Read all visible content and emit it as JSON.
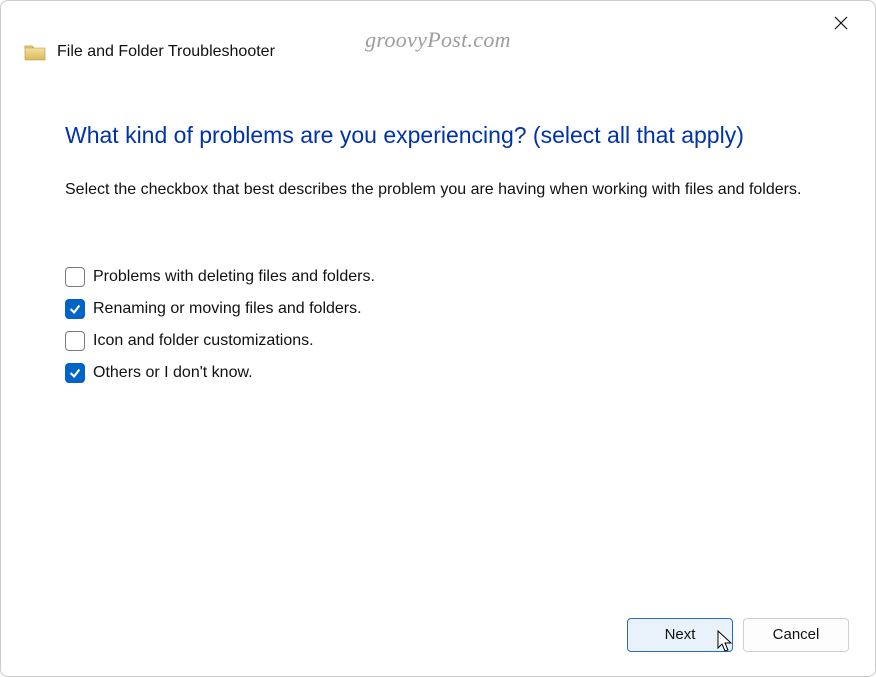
{
  "watermark": "groovyPost.com",
  "titlebar": {
    "title": "File and Folder Troubleshooter"
  },
  "content": {
    "heading": "What kind of problems are you experiencing? (select all that apply)",
    "description": "Select the checkbox that best describes the problem you are having when working with files and folders."
  },
  "options": [
    {
      "label": "Problems with deleting files and folders.",
      "checked": false
    },
    {
      "label": "Renaming or moving files and folders.",
      "checked": true
    },
    {
      "label": "Icon and folder customizations.",
      "checked": false
    },
    {
      "label": "Others or I don't know.",
      "checked": true
    }
  ],
  "footer": {
    "next": "Next",
    "cancel": "Cancel"
  }
}
